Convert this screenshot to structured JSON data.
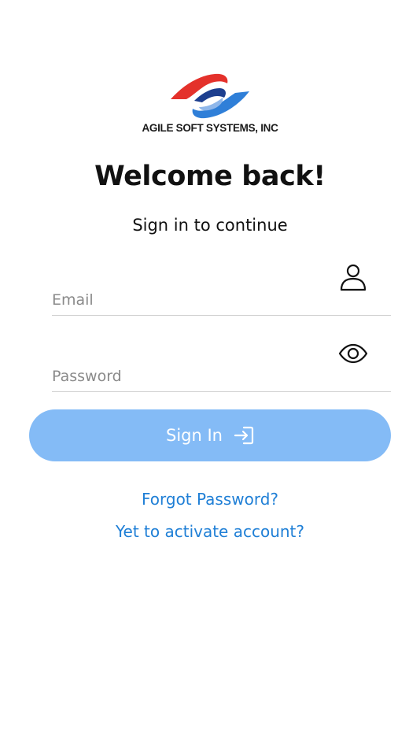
{
  "logo": {
    "company_name": "AGILE SOFT SYSTEMS, INC",
    "icon": "agile-soft-logo-mark",
    "colors": {
      "red": "#e4312b",
      "blue": "#2f7fd8",
      "navy": "#1d3f8f"
    }
  },
  "header": {
    "title": "Welcome back!",
    "subtitle": "Sign in to continue"
  },
  "form": {
    "email": {
      "value": "",
      "placeholder": "Email",
      "icon": "user-icon"
    },
    "password": {
      "value": "",
      "placeholder": "Password",
      "icon": "eye-icon"
    },
    "submit": {
      "label": "Sign In",
      "icon": "sign-in-arrow-icon",
      "background": "#84bbf6"
    }
  },
  "links": {
    "forgot_password": "Forgot Password?",
    "activate_account": "Yet to activate account?",
    "color": "#1f7fd6"
  }
}
